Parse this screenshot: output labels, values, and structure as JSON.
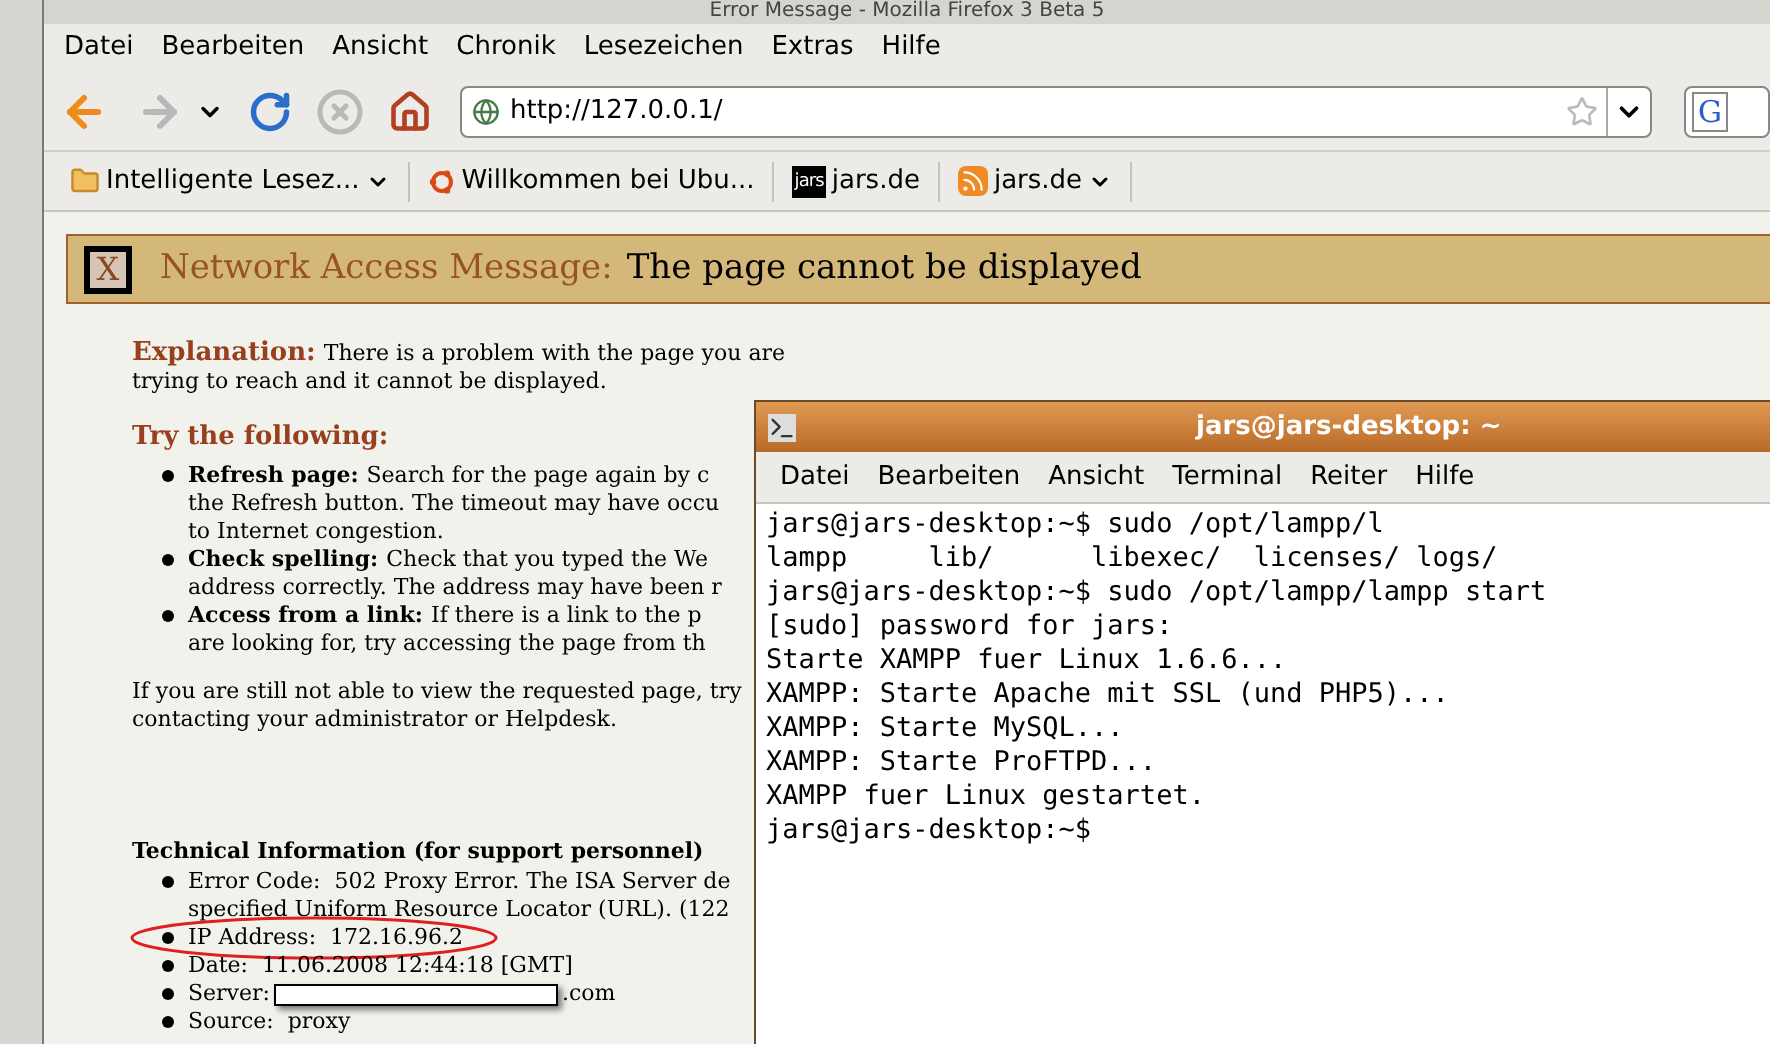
{
  "window": {
    "title": "Error Message - Mozilla Firefox 3 Beta 5"
  },
  "menu": [
    {
      "label": "Datei"
    },
    {
      "label": "Bearbeiten"
    },
    {
      "label": "Ansicht"
    },
    {
      "label": "Chronik"
    },
    {
      "label": "Lesezeichen"
    },
    {
      "label": "Extras"
    },
    {
      "label": "Hilfe"
    }
  ],
  "toolbar": {
    "url": "http://127.0.0.1/",
    "search_engine": "G"
  },
  "bookmarks": [
    {
      "kind": "folder",
      "label": "Intelligente Lesez...",
      "dropdown": true
    },
    {
      "kind": "ubuntu",
      "label": "Willkommen bei Ubu...",
      "dropdown": false
    },
    {
      "kind": "jars",
      "icon_text": "jars",
      "label": "jars.de",
      "dropdown": false
    },
    {
      "kind": "feed",
      "label": "jars.de",
      "dropdown": true
    }
  ],
  "error_page": {
    "banner": {
      "icon": "X",
      "label": "Network Access Message:",
      "title": "The page cannot be displayed"
    },
    "explanation": {
      "heading": "Explanation:",
      "lines": [
        "There is a problem with the page you are",
        "trying to reach and it cannot be displayed."
      ]
    },
    "try_heading": "Try the following:",
    "suggestions": [
      {
        "term": "Refresh page:",
        "lines": [
          "Search for the page again by c",
          "the Refresh button. The timeout may have occu",
          "to Internet congestion."
        ]
      },
      {
        "term": "Check spelling:",
        "lines": [
          "Check that you typed the We",
          "address correctly. The address may have been r"
        ]
      },
      {
        "term": "Access from a link:",
        "lines": [
          "If there is a link to the p",
          "are looking for, try accessing the page from th"
        ]
      }
    ],
    "still_lines": [
      "If you are still not able to view the requested page, try",
      "contacting your administrator or Helpdesk."
    ],
    "tech_heading": "Technical Information (for support personnel)",
    "tech_items": [
      {
        "kind": "text",
        "highlighted": false,
        "lines": [
          "Error Code:  502 Proxy Error. The ISA Server de",
          "specified Uniform Resource Locator (URL). (122"
        ]
      },
      {
        "kind": "text",
        "highlighted": true,
        "lines": [
          "IP Address:  172.16.96.2"
        ]
      },
      {
        "kind": "text",
        "highlighted": false,
        "lines": [
          "Date:  11.06.2008 12:44:18 [GMT]"
        ]
      },
      {
        "kind": "redacted",
        "highlighted": false,
        "label": "Server:",
        "suffix": ".com"
      },
      {
        "kind": "text",
        "highlighted": false,
        "lines": [
          "Source:  proxy"
        ]
      }
    ]
  },
  "terminal": {
    "title": "jars@jars-desktop: ~",
    "menu": [
      {
        "label": "Datei"
      },
      {
        "label": "Bearbeiten"
      },
      {
        "label": "Ansicht"
      },
      {
        "label": "Terminal"
      },
      {
        "label": "Reiter"
      },
      {
        "label": "Hilfe"
      }
    ],
    "lines": [
      "jars@jars-desktop:~$ sudo /opt/lampp/l",
      "lampp     lib/      libexec/  licenses/ logs/",
      "jars@jars-desktop:~$ sudo /opt/lampp/lampp start",
      "[sudo] password for jars:",
      "Starte XAMPP fuer Linux 1.6.6...",
      "XAMPP: Starte Apache mit SSL (und PHP5)...",
      "XAMPP: Starte MySQL...",
      "XAMPP: Starte ProFTPD...",
      "XAMPP fuer Linux gestartet.",
      "jars@jars-desktop:~$"
    ]
  }
}
